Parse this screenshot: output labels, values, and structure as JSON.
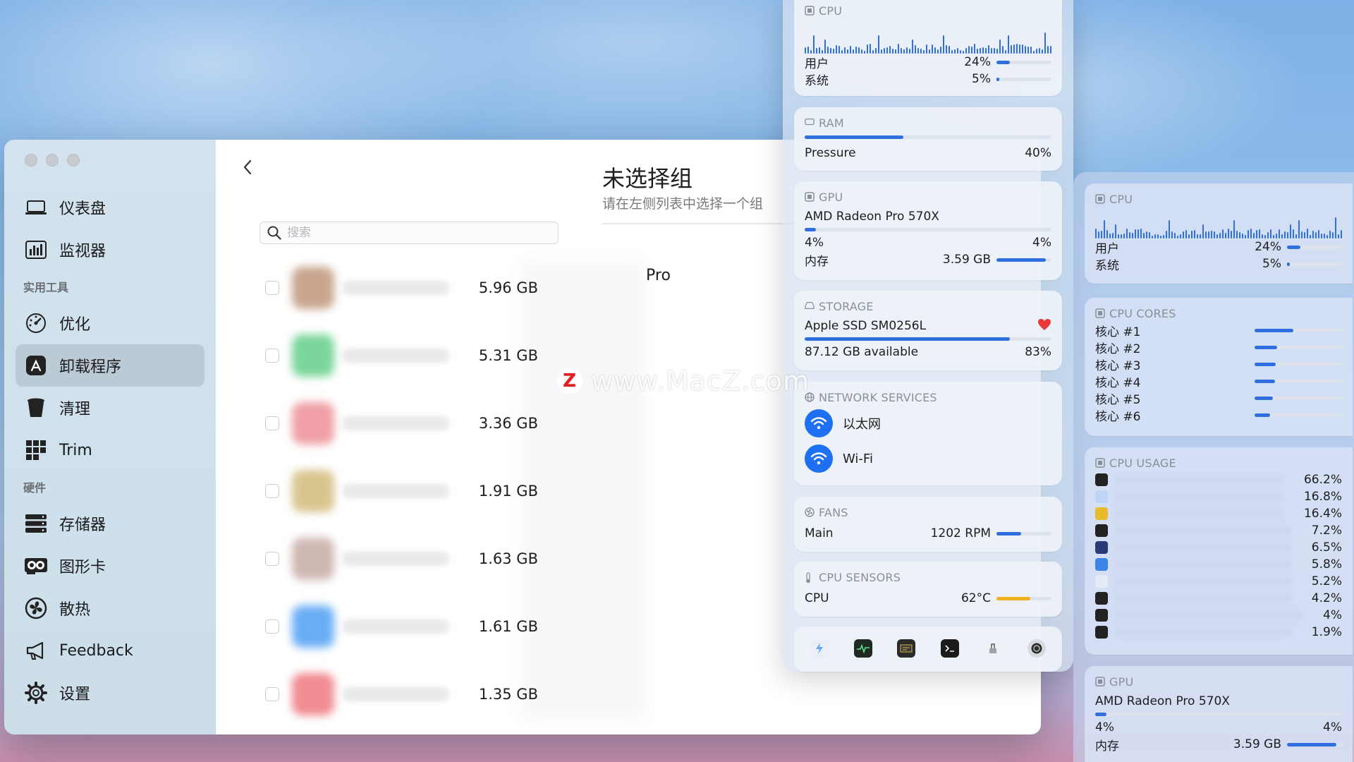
{
  "sidebar": {
    "items": [
      {
        "label": "仪表盘",
        "icon": "laptop-icon"
      },
      {
        "label": "监视器",
        "icon": "chart-icon"
      },
      {
        "label": "优化",
        "icon": "gauge-icon"
      },
      {
        "label": "卸载程序",
        "icon": "app-store-icon"
      },
      {
        "label": "清理",
        "icon": "trash-icon"
      },
      {
        "label": "Trim",
        "icon": "grid-icon"
      },
      {
        "label": "存储器",
        "icon": "server-icon"
      },
      {
        "label": "图形卡",
        "icon": "gpu-icon"
      },
      {
        "label": "散热",
        "icon": "fan-icon"
      },
      {
        "label": "Feedback",
        "icon": "megaphone-icon"
      },
      {
        "label": "设置",
        "icon": "gear-icon"
      }
    ],
    "sections": {
      "tools": "实用工具",
      "hardware": "硬件"
    }
  },
  "main": {
    "search_placeholder": "搜索",
    "apps": [
      {
        "size": "5.96 GB",
        "color": "#c9a58e"
      },
      {
        "size": "5.31 GB",
        "color": "#7ad69a"
      },
      {
        "size": "3.36 GB",
        "color": "#f0a0a6"
      },
      {
        "size": "1.91 GB",
        "color": "#d8c58e"
      },
      {
        "size": "1.63 GB",
        "color": "#cfb7b2"
      },
      {
        "size": "1.61 GB",
        "color": "#6aaef5"
      },
      {
        "size": "1.35 GB",
        "color": "#f08c92"
      }
    ],
    "partial_name": "Pro",
    "group_title": "未选择组",
    "group_subtitle": "请在左侧列表中选择一个组"
  },
  "stats": {
    "cpu": {
      "title": "CPU",
      "user_label": "用户",
      "user_value": "24%",
      "user_frac": 0.24,
      "system_label": "系统",
      "system_value": "5%",
      "system_frac": 0.05
    },
    "ram": {
      "title": "RAM",
      "pressure_label": "Pressure",
      "pressure_value": "40%",
      "pressure_frac": 0.4
    },
    "gpu": {
      "title": "GPU",
      "name": "AMD Radeon Pro 570X",
      "util_left": "4%",
      "util_right": "4%",
      "util_frac": 0.04,
      "mem_label": "内存",
      "mem_value": "3.59 GB",
      "mem_frac": 0.9
    },
    "storage": {
      "title": "STORAGE",
      "name": "Apple SSD SM0256L",
      "available": "87.12 GB available",
      "percent": "83%",
      "frac": 0.83
    },
    "network": {
      "title": "NETWORK SERVICES",
      "services": [
        "以太网",
        "Wi-Fi"
      ]
    },
    "fans": {
      "title": "FANS",
      "label": "Main",
      "value": "1202 RPM",
      "frac": 0.45
    },
    "sensors": {
      "title": "CPU SENSORS",
      "label": "CPU",
      "value": "62°C",
      "frac": 0.62
    }
  },
  "stats2": {
    "cpu": {
      "title": "CPU",
      "user_label": "用户",
      "user_value": "24%",
      "user_frac": 0.24,
      "system_label": "系统",
      "system_value": "5%",
      "system_frac": 0.05
    },
    "cores": {
      "title": "CPU CORES",
      "items": [
        {
          "label": "核心 #1",
          "frac": 0.44
        },
        {
          "label": "核心 #2",
          "frac": 0.26
        },
        {
          "label": "核心 #3",
          "frac": 0.24
        },
        {
          "label": "核心 #4",
          "frac": 0.23
        },
        {
          "label": "核心 #5",
          "frac": 0.21
        },
        {
          "label": "核心 #6",
          "frac": 0.18
        }
      ]
    },
    "usage": {
      "title": "CPU USAGE",
      "items": [
        {
          "value": "66.2%",
          "color": "#222222"
        },
        {
          "value": "16.8%",
          "color": "#bfd5f7"
        },
        {
          "value": "16.4%",
          "color": "#e9bb2c"
        },
        {
          "value": "7.2%",
          "color": "#222222"
        },
        {
          "value": "6.5%",
          "color": "#2a3b7a"
        },
        {
          "value": "5.8%",
          "color": "#3a86e8"
        },
        {
          "value": "5.2%",
          "color": "#e6ecf5"
        },
        {
          "value": "4.2%",
          "color": "#222222"
        },
        {
          "value": "4%",
          "color": "#222222"
        },
        {
          "value": "1.9%",
          "color": "#222222"
        }
      ]
    },
    "gpu": {
      "title": "GPU",
      "name": "AMD Radeon Pro 570X",
      "util_left": "4%",
      "util_right": "4%",
      "util_frac": 0.04,
      "mem_label": "内存",
      "mem_value": "3.59 GB",
      "mem_frac": 0.9
    }
  },
  "watermark": {
    "logo": "Z",
    "text": "www.MacZ.com"
  },
  "colors": {
    "accent": "#2f6fe0",
    "temp": "#f0b020",
    "heart": "#e8383b",
    "wifi": "#1f6ff2"
  }
}
